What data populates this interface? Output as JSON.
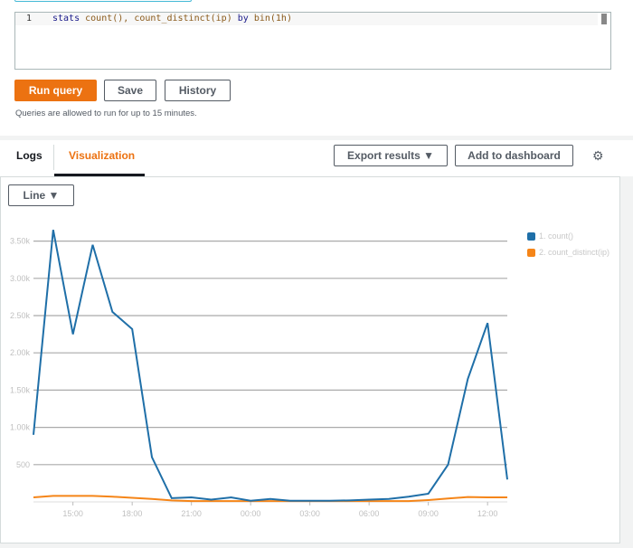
{
  "editor": {
    "line_number": "1",
    "query_kw": "stats",
    "query_fn1": "count(),",
    "query_fn2": "count_distinct(ip)",
    "query_by": "by",
    "query_bin": "bin(1h)"
  },
  "buttons": {
    "run": "Run query",
    "save": "Save",
    "history": "History",
    "export": "Export results ▼",
    "add_dashboard": "Add to dashboard",
    "chart_type": "Line ▼"
  },
  "note": "Queries are allowed to run for up to 15 minutes.",
  "tabs": [
    {
      "label": "Logs"
    },
    {
      "label": "Visualization",
      "active": true
    }
  ],
  "colors": {
    "accent": "#ec7211",
    "series1": "#1f6fa8",
    "series2": "#f58518"
  },
  "chart_data": {
    "type": "line",
    "x": [
      "13:00",
      "14:00",
      "15:00",
      "16:00",
      "17:00",
      "18:00",
      "19:00",
      "20:00",
      "21:00",
      "22:00",
      "23:00",
      "00:00",
      "01:00",
      "02:00",
      "03:00",
      "04:00",
      "05:00",
      "06:00",
      "07:00",
      "08:00",
      "09:00",
      "10:00",
      "11:00",
      "12:00",
      "13:00"
    ],
    "xticks": [
      "15:00",
      "18:00",
      "21:00",
      "00:00",
      "03:00",
      "06:00",
      "09:00",
      "12:00"
    ],
    "yticks": [
      {
        "v": 500,
        "label": "500"
      },
      {
        "v": 1000,
        "label": "1.00k"
      },
      {
        "v": 1500,
        "label": "1.50k"
      },
      {
        "v": 2000,
        "label": "2.00k"
      },
      {
        "v": 2500,
        "label": "2.50k"
      },
      {
        "v": 3000,
        "label": "3.00k"
      },
      {
        "v": 3500,
        "label": "3.50k"
      }
    ],
    "ylim": [
      0,
      3800
    ],
    "grid": true,
    "legend_position": "right",
    "series": [
      {
        "name": "1. count()",
        "values": [
          900,
          3650,
          2250,
          3450,
          2550,
          2320,
          600,
          50,
          60,
          30,
          60,
          15,
          40,
          15,
          15,
          15,
          20,
          30,
          40,
          70,
          110,
          500,
          1650,
          2400,
          300
        ]
      },
      {
        "name": "2. count_distinct(ip)",
        "values": [
          60,
          80,
          80,
          80,
          70,
          55,
          40,
          20,
          10,
          10,
          10,
          10,
          10,
          10,
          10,
          10,
          10,
          10,
          10,
          10,
          25,
          45,
          65,
          60,
          60
        ]
      }
    ]
  }
}
